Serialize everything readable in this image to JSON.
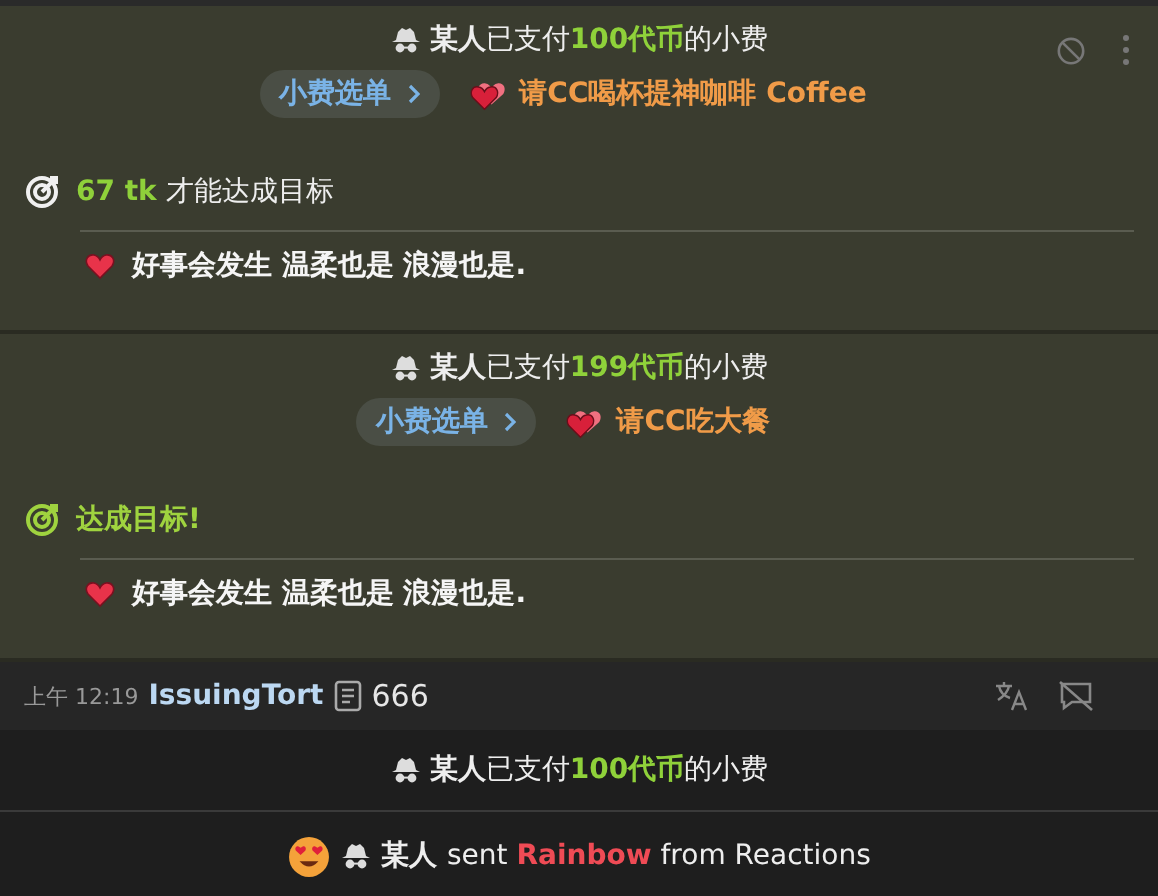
{
  "tip_cards": [
    {
      "payer": "某人",
      "verb": "已支付",
      "amount": "100代币",
      "suffix": "的小费",
      "menu_button": "小费选单",
      "item": "请CC喝杯提神咖啡 Coffee",
      "goal": {
        "amount": "67 tk",
        "text": "才能达成目标",
        "reached": false
      },
      "message": "好事会发生 温柔也是 浪漫也是.",
      "actions": true
    },
    {
      "payer": "某人",
      "verb": "已支付",
      "amount": "199代币",
      "suffix": "的小费",
      "menu_button": "小费选单",
      "item": "请CC吃大餐",
      "goal": {
        "text": "达成目标!",
        "reached": true
      },
      "message": "好事会发生 温柔也是 浪漫也是.",
      "actions": false
    }
  ],
  "chat_message": {
    "time": "上午 12:19",
    "username": "IssuingTort",
    "text": "666"
  },
  "tip_line": {
    "payer": "某人",
    "verb": "已支付",
    "amount": "100代币",
    "suffix": "的小费"
  },
  "reaction_line": {
    "sender": "某人",
    "verb": "sent",
    "reaction": "Rainbow",
    "suffix": "from Reactions"
  }
}
